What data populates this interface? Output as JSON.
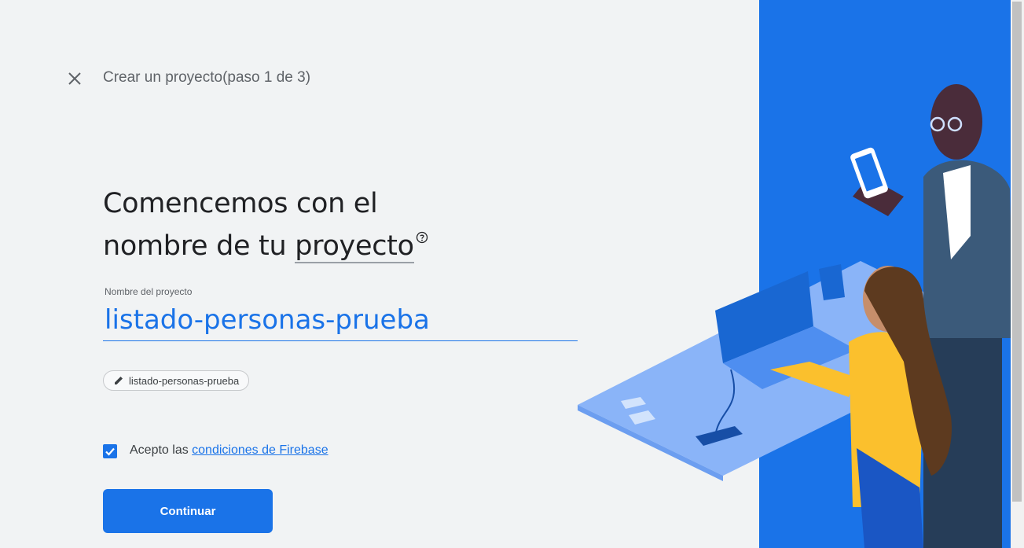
{
  "header": {
    "step_title": "Crear un proyecto(paso 1 de 3)"
  },
  "main": {
    "heading_line1": "Comencemos con el",
    "heading_line2_prefix": "nombre de tu ",
    "heading_link": "proyecto",
    "field_label": "Nombre del proyecto",
    "project_name_value": "listado-personas-prueba",
    "project_id_chip": "listado-personas-prueba",
    "terms_prefix": "Acepto las ",
    "terms_link": "condiciones de Firebase",
    "terms_checked": true,
    "continue_label": "Continuar"
  },
  "icons": {
    "close": "close-icon",
    "help": "help-icon",
    "edit": "pencil-icon",
    "check": "check-icon"
  },
  "colors": {
    "accent": "#1a73e8",
    "background": "#f1f3f4",
    "text": "#202124"
  }
}
